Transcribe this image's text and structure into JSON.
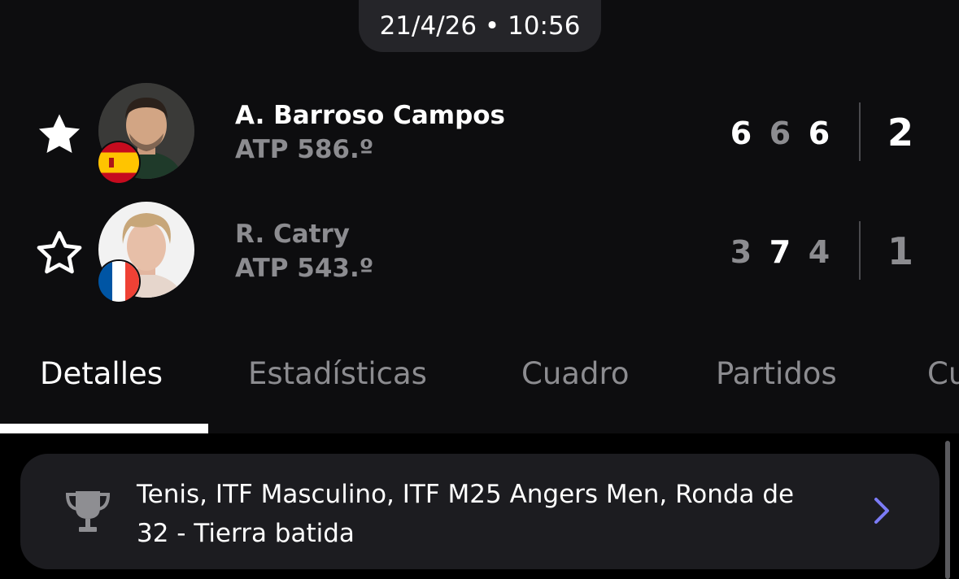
{
  "datetime": "21/4/26 • 10:56",
  "players": [
    {
      "name": "A. Barroso Campos",
      "ranking": "ATP 586.º",
      "favorite": true,
      "flag": "spain-flag",
      "set_scores": [
        "6",
        "6",
        "6"
      ],
      "sets_won": "2"
    },
    {
      "name": "R. Catry",
      "ranking": "ATP 543.º",
      "favorite": false,
      "flag": "france-flag",
      "set_scores": [
        "3",
        "7",
        "4"
      ],
      "sets_won": "1"
    }
  ],
  "tabs": [
    "Detalles",
    "Estadísticas",
    "Cuadro",
    "Partidos",
    "Cu"
  ],
  "active_tab": "Detalles",
  "tournament": {
    "line1": "Tenis, ITF Masculino, ITF M25 Angers Men, Ronda de",
    "line2": "32 - Tierra batida"
  },
  "colors": {
    "background": "#0d0d0f",
    "muted_text": "#8c8c90",
    "card": "#1c1c20",
    "chevron_accent": "#7b7bf5"
  }
}
